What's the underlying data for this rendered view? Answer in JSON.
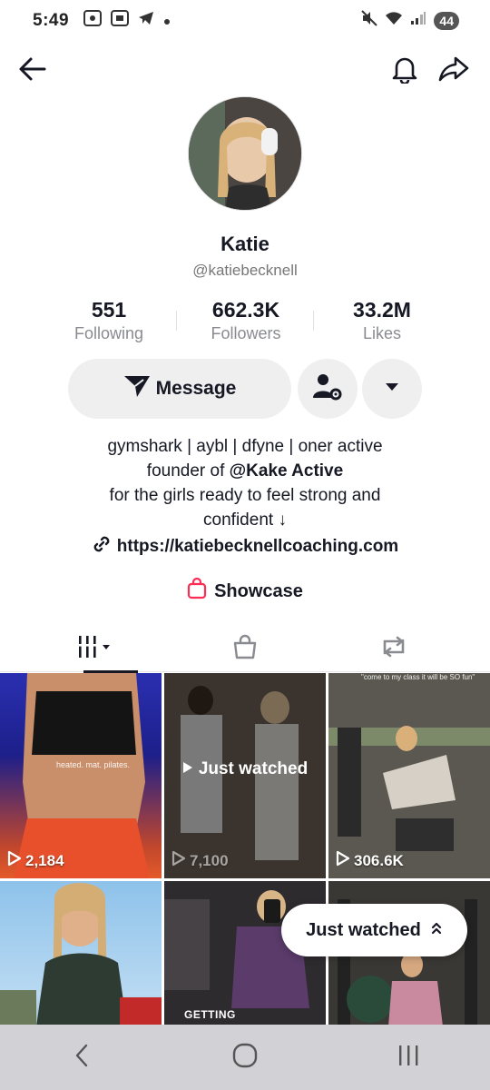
{
  "status_bar": {
    "time": "5:49",
    "battery": "44"
  },
  "profile": {
    "name": "Katie",
    "handle": "@katiebecknell",
    "stats": [
      {
        "value": "551",
        "label": "Following"
      },
      {
        "value": "662.3K",
        "label": "Followers"
      },
      {
        "value": "33.2M",
        "label": "Likes"
      }
    ],
    "message_label": "Message",
    "bio": {
      "line1": "gymshark | aybl | dfyne | oner active",
      "line2_prefix": "founder of ",
      "line2_mention": "@Kake Active",
      "line3": "for the girls ready to feel strong and",
      "line4": "confident ↓"
    },
    "link": "https://katiebecknellcoaching.com",
    "showcase_label": "Showcase"
  },
  "videos": [
    {
      "views": "2,184",
      "caption": "heated. mat. pilates."
    },
    {
      "views": "7,100",
      "just_watched": "Just watched"
    },
    {
      "views": "306.6K",
      "caption": "\"come to my class it will be SO fun\""
    },
    {
      "views": ""
    },
    {
      "views": "",
      "overlay_text": "GETTING"
    },
    {
      "views": ""
    }
  ],
  "just_watched_pill": "Just watched",
  "colors": {
    "accent": "#fe2c55",
    "button_bg": "#efeff0",
    "text_primary": "#161823",
    "text_secondary": "#8a8b91"
  }
}
